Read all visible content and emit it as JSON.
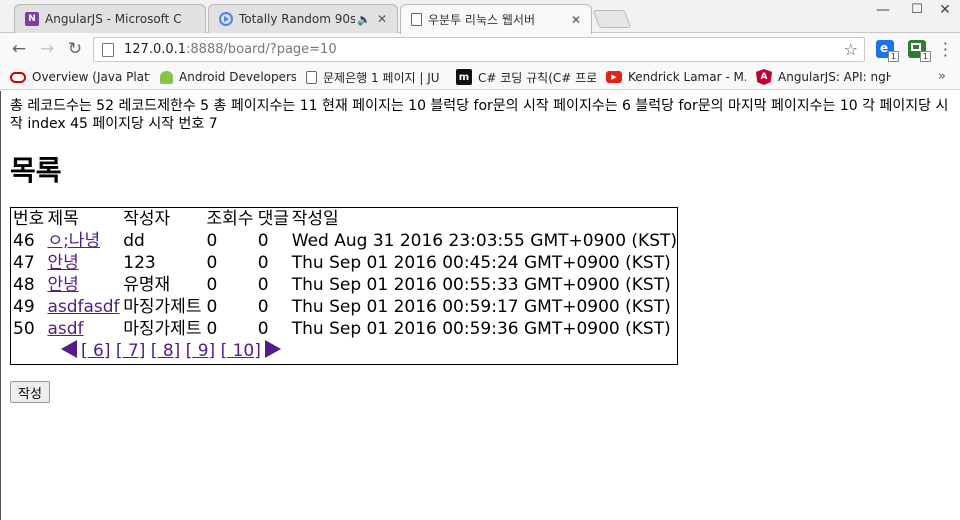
{
  "tabs": [
    {
      "title": "AngularJS - Microsoft C",
      "icon": "onenote-icon"
    },
    {
      "title": "Totally Random 90s",
      "icon": "playing-media-icon"
    },
    {
      "title": "우분투 리눅스 웹서버",
      "icon": "page-icon"
    }
  ],
  "toolbar": {
    "url_host": "127.0.0.1",
    "url_rest": ":8888/board/?page=10",
    "ext1_badge": "1",
    "ext2_badge": "1"
  },
  "bookmarks": [
    {
      "label": "Overview (Java Platf",
      "icon": "oracle-icon",
      "color": "#cc0000"
    },
    {
      "label": "Android Developers",
      "icon": "android-icon",
      "color": "#8bc34a"
    },
    {
      "label": "문제은행 1 페이지 | JU",
      "icon": "page-icon",
      "color": "#ffffff"
    },
    {
      "label": "C# 코딩 규칙(C# 프로",
      "icon": "microsoft-icon",
      "color": "#222222"
    },
    {
      "label": "Kendrick Lamar - M.A.",
      "icon": "youtube-icon",
      "color": "#e62117"
    },
    {
      "label": "AngularJS: API: ngHtt",
      "icon": "angular-icon",
      "color": "#c3002f"
    }
  ],
  "bookmarks_more": "»",
  "page": {
    "summary": "총 레코드수는 52 레코드제한수 5 총 페이지수는 11 현재 페이지는 10 블럭당 for문의 시작 페이지수는 6 블럭당 for문의 마지막 페이지수는 10 각 페이지당 시작 index 45 페이지당 시작 번호 7",
    "heading": "목록",
    "columns": [
      "번호",
      "제목",
      "작성자",
      "조회수",
      "댓글",
      "작성일"
    ],
    "rows": [
      {
        "no": "46",
        "title": "ㅇ;나녕",
        "author": "dd",
        "views": "0",
        "comments": "0",
        "date": "Wed Aug 31 2016 23:03:55 GMT+0900 (KST)"
      },
      {
        "no": "47",
        "title": "안녕",
        "author": "123",
        "views": "0",
        "comments": "0",
        "date": "Thu Sep 01 2016 00:45:24 GMT+0900 (KST)"
      },
      {
        "no": "48",
        "title": "안녕",
        "author": "유명재",
        "views": "0",
        "comments": "0",
        "date": "Thu Sep 01 2016 00:55:33 GMT+0900 (KST)"
      },
      {
        "no": "49",
        "title": "asdfasdf",
        "author": "마징가제트",
        "views": "0",
        "comments": "0",
        "date": "Thu Sep 01 2016 00:59:17 GMT+0900 (KST)"
      },
      {
        "no": "50",
        "title": "asdf",
        "author": "마징가제트",
        "views": "0",
        "comments": "0",
        "date": "Thu Sep 01 2016 00:59:36 GMT+0900 (KST)"
      }
    ],
    "pages": [
      "[ 6]",
      "[ 7]",
      "[ 8]",
      "[ 9]",
      "[ 10]"
    ],
    "write_button": "작성"
  }
}
